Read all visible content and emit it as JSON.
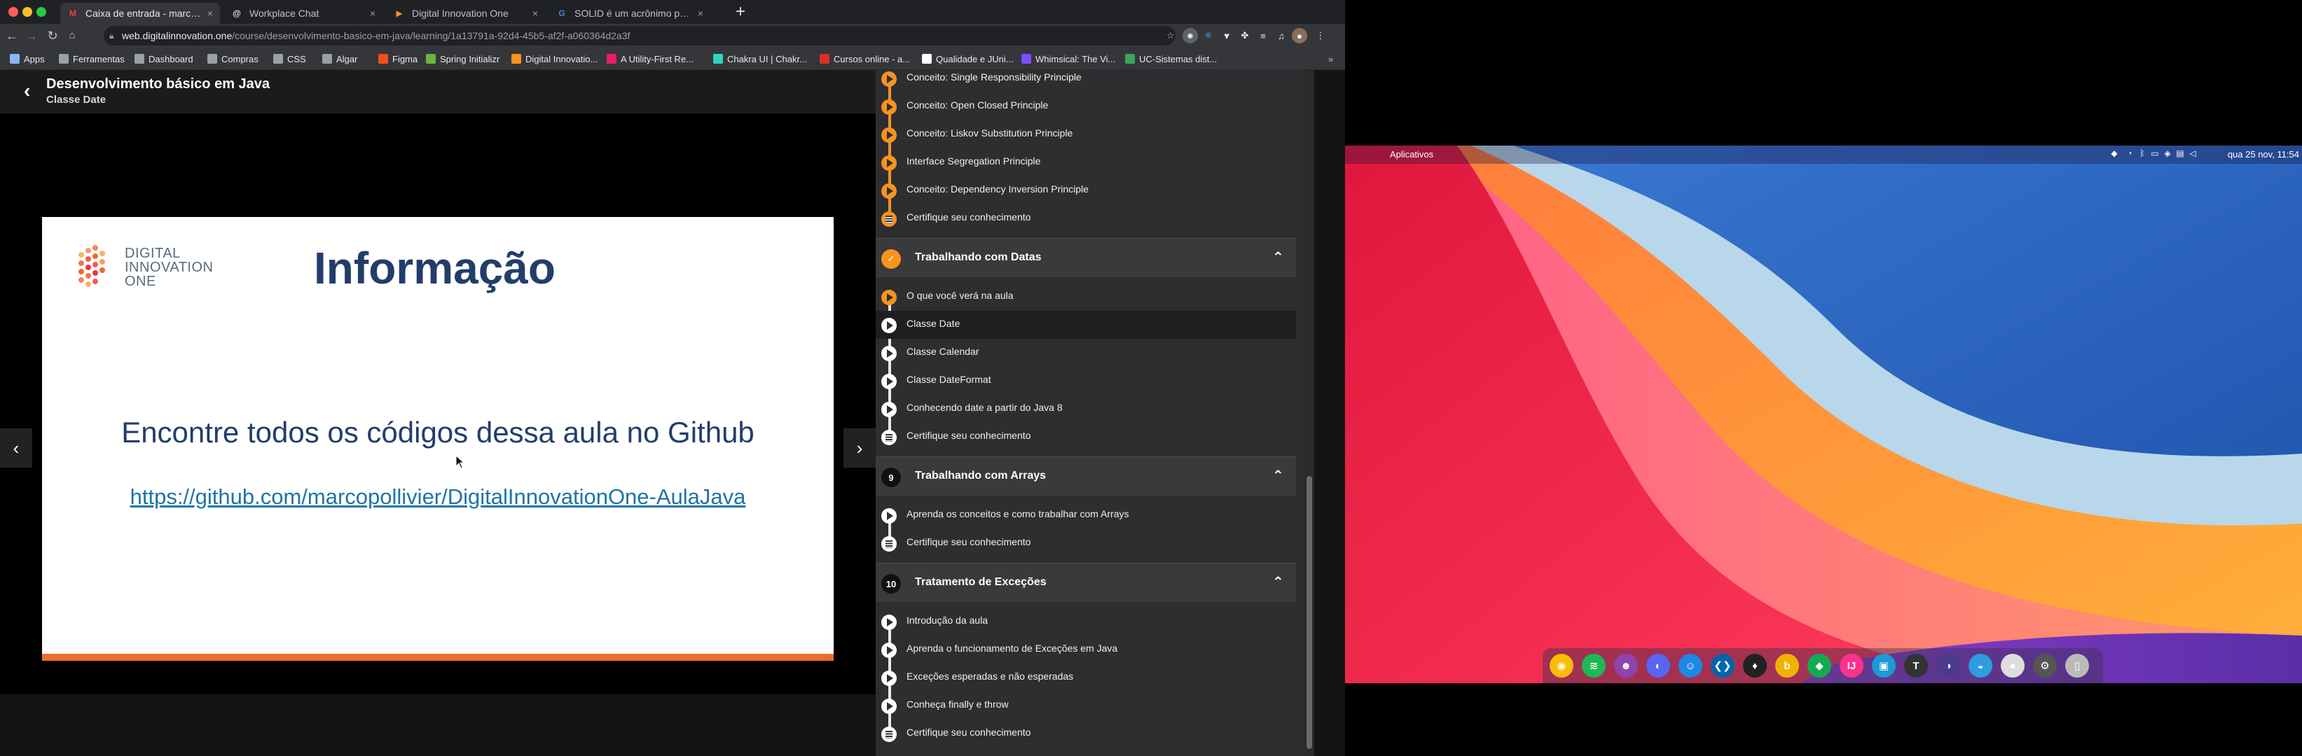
{
  "browser": {
    "tabs": [
      {
        "title": "Caixa de entrada - marcosvom",
        "icon": "gmail-icon",
        "color": "#ea4335",
        "glyph": "M"
      },
      {
        "title": "Workplace Chat",
        "icon": "workplace-icon",
        "color": "#e8eaed",
        "glyph": "@"
      },
      {
        "title": "Digital Innovation One",
        "icon": "dio-icon",
        "color": "#f7931e",
        "glyph": "▶"
      },
      {
        "title": "SOLID é um acrônimo para: - B",
        "icon": "google-icon",
        "color": "#4285f4",
        "glyph": "G"
      }
    ],
    "url_host": "web.digitalinnovation.one",
    "url_path": "/course/desenvolvimento-basico-em-java/learning/1a13791a-92d4-45b5-af2f-a060364d2a3f",
    "bookmarks": [
      {
        "label": "Apps",
        "icon": "apps-grid-icon",
        "color": "#8ab4f8"
      },
      {
        "label": "Ferramentas",
        "icon": "folder-icon",
        "color": "#9aa0a6"
      },
      {
        "label": "Dashboard",
        "icon": "folder-icon",
        "color": "#9aa0a6"
      },
      {
        "label": "Compras",
        "icon": "folder-icon",
        "color": "#9aa0a6"
      },
      {
        "label": "CSS",
        "icon": "folder-icon",
        "color": "#9aa0a6"
      },
      {
        "label": "Algar",
        "icon": "folder-icon",
        "color": "#9aa0a6"
      },
      {
        "label": "Figma",
        "icon": "figma-icon",
        "color": "#f24e1e"
      },
      {
        "label": "Spring Initializr",
        "icon": "spring-icon",
        "color": "#6db33f"
      },
      {
        "label": "Digital Innovatio...",
        "icon": "dio-icon",
        "color": "#f7931e"
      },
      {
        "label": "A Utility-First Re...",
        "icon": "tailwind-icon",
        "color": "#e91e63"
      },
      {
        "label": "Chakra UI | Chakr...",
        "icon": "chakra-icon",
        "color": "#2dd4bf"
      },
      {
        "label": "Cursos online - a...",
        "icon": "alura-icon",
        "color": "#d93025"
      },
      {
        "label": "Qualidade e JUni...",
        "icon": "medium-icon",
        "color": "#ffffff"
      },
      {
        "label": "Whimsical: The Vi...",
        "icon": "whimsical-icon",
        "color": "#7b4fff"
      },
      {
        "label": "UC-Sistemas dist...",
        "icon": "uc-icon",
        "color": "#3ba55d"
      }
    ]
  },
  "course": {
    "title": "Desenvolvimento básico em Java",
    "lesson": "Classe Date"
  },
  "slide": {
    "logo": [
      "DIGITAL",
      "INNOVATION",
      "ONE"
    ],
    "heading": "Informação",
    "text": "Encontre todos os códigos dessa aula no Github",
    "link": "https://github.com/marcopollivier/DigitalInnovationOne-AulaJava",
    "accent": "#ee6b2a"
  },
  "sidebar": {
    "prev_lessons": [
      {
        "label": "Conceito: Single Responsibility Principle",
        "kind": "video",
        "done": true
      },
      {
        "label": "Conceito: Open Closed Principle",
        "kind": "video",
        "done": true
      },
      {
        "label": "Conceito: Liskov Substitution Principle",
        "kind": "video",
        "done": true
      },
      {
        "label": "Interface Segregation Principle",
        "kind": "video",
        "done": true
      },
      {
        "label": "Conceito: Dependency Inversion Principle",
        "kind": "video",
        "done": true
      },
      {
        "label": "Certifique seu conhecimento",
        "kind": "quiz",
        "done": true
      }
    ],
    "modules": [
      {
        "number": "",
        "title": "Trabalhando com Datas",
        "done": true,
        "lessons": [
          {
            "label": "O que você verá na aula",
            "kind": "video",
            "done": true
          },
          {
            "label": "Classe Date",
            "kind": "video",
            "active": true
          },
          {
            "label": "Classe Calendar",
            "kind": "video"
          },
          {
            "label": "Classe DateFormat",
            "kind": "video"
          },
          {
            "label": "Conhecendo date a partir do Java 8",
            "kind": "video"
          },
          {
            "label": "Certifique seu conhecimento",
            "kind": "quiz"
          }
        ]
      },
      {
        "number": "9",
        "title": "Trabalhando com Arrays",
        "lessons": [
          {
            "label": "Aprenda os conceitos e como trabalhar com Arrays",
            "kind": "video"
          },
          {
            "label": "Certifique seu conhecimento",
            "kind": "quiz"
          }
        ]
      },
      {
        "number": "10",
        "title": "Tratamento de Exceções",
        "lessons": [
          {
            "label": "Introdução da aula",
            "kind": "video"
          },
          {
            "label": "Aprenda o funcionamento de Exceções em Java",
            "kind": "video"
          },
          {
            "label": "Exceções esperadas e não esperadas",
            "kind": "video"
          },
          {
            "label": "Conheça finally e throw",
            "kind": "video"
          },
          {
            "label": "Certifique seu conhecimento",
            "kind": "quiz"
          }
        ]
      }
    ]
  },
  "desktop": {
    "menu_label": "Aplicativos",
    "clock": "qua 25 nov, 11:54",
    "dock": [
      {
        "name": "chrome-icon",
        "color": "#fbbc05",
        "glyph": "◉"
      },
      {
        "name": "spotify-icon",
        "color": "#1db954",
        "glyph": "≋"
      },
      {
        "name": "game-icon",
        "color": "#8e44ad",
        "glyph": "☻"
      },
      {
        "name": "discord-icon",
        "color": "#5865f2",
        "glyph": "◐"
      },
      {
        "name": "finder-icon",
        "color": "#1e88e5",
        "glyph": "☺"
      },
      {
        "name": "vscode-icon",
        "color": "#0065a9",
        "glyph": "❮❯"
      },
      {
        "name": "insomnia-icon",
        "color": "#222222",
        "glyph": "♦"
      },
      {
        "name": "bitwarden-icon",
        "color": "#f0b400",
        "glyph": "b"
      },
      {
        "name": "mongodb-icon",
        "color": "#13aa52",
        "glyph": "◆"
      },
      {
        "name": "intellij-icon",
        "color": "#fc318c",
        "glyph": "IJ"
      },
      {
        "name": "virtualbox-icon",
        "color": "#1a9ad6",
        "glyph": "▣"
      },
      {
        "name": "typora-icon",
        "color": "#333333",
        "glyph": "T"
      },
      {
        "name": "eclipse-icon",
        "color": "#4b3b8f",
        "glyph": "◑"
      },
      {
        "name": "browser-icon",
        "color": "#2e9de0",
        "glyph": "◒"
      },
      {
        "name": "disk-icon",
        "color": "#dddddd",
        "glyph": "●"
      },
      {
        "name": "settings-icon",
        "color": "#555555",
        "glyph": "⚙"
      },
      {
        "name": "trash-icon",
        "color": "#bbbbbb",
        "glyph": "▯"
      }
    ]
  }
}
